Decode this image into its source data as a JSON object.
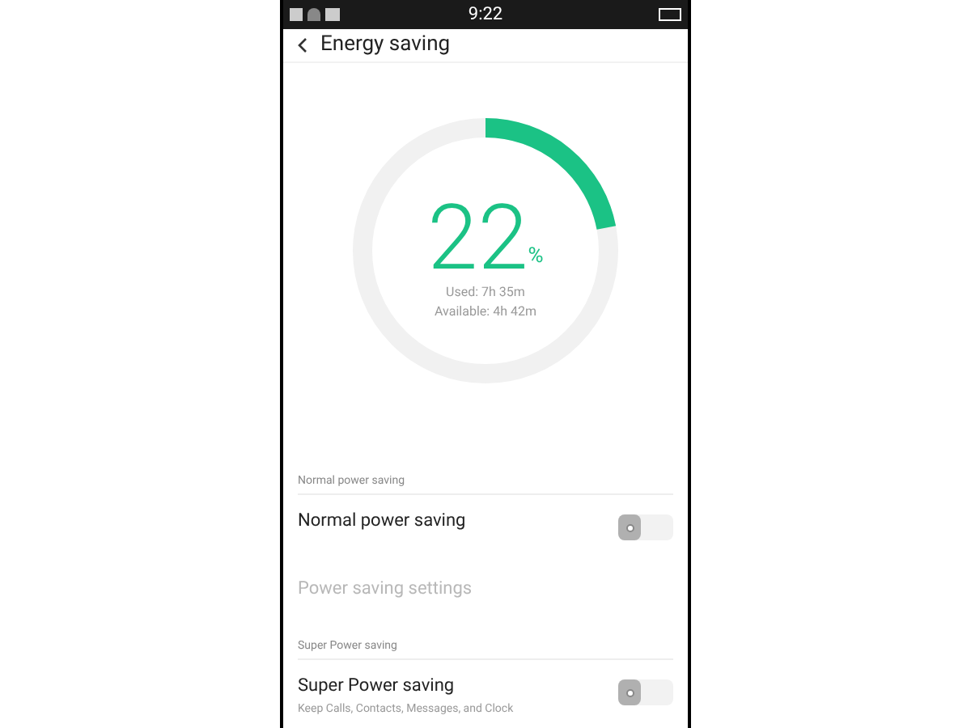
{
  "status_bar": {
    "time": "9:22"
  },
  "header": {
    "title": "Energy saving"
  },
  "battery": {
    "level": 0.22,
    "percent": "22",
    "unit": "%",
    "used": "Used: 7h 35m",
    "available": "Available: 4h 42m"
  },
  "sections": [
    {
      "heading": "Normal power saving",
      "items": [
        {
          "kind": "toggle",
          "label": "Normal power saving",
          "on": false
        },
        {
          "kind": "link",
          "label": "Power saving settings",
          "disabled": true
        }
      ]
    },
    {
      "heading": "Super Power saving",
      "items": [
        {
          "kind": "toggle",
          "label": "Super Power saving",
          "subtitle": "Keep Calls, Contacts, Messages, and Clock",
          "on": false
        }
      ]
    }
  ]
}
